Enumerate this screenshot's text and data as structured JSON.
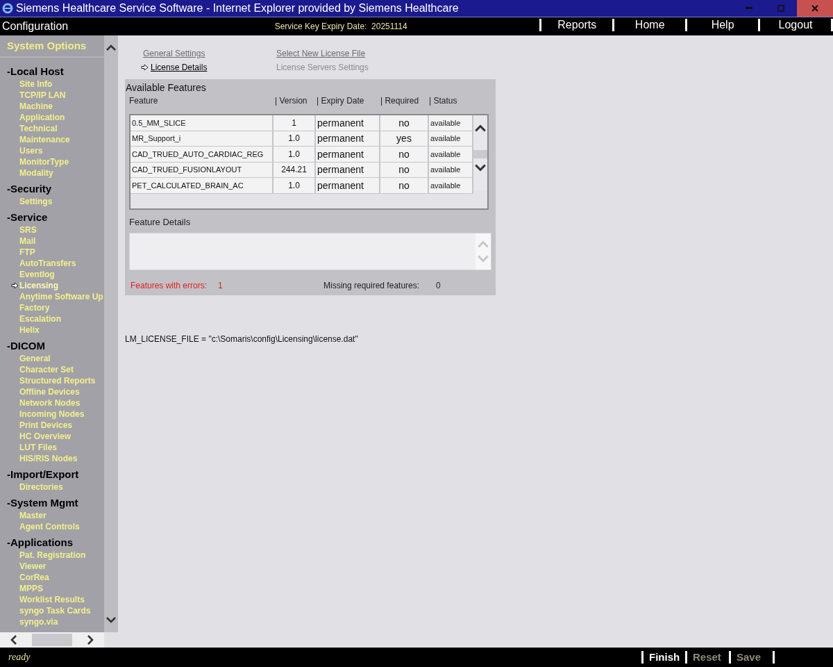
{
  "window": {
    "title": "Siemens Healthcare Service Software - Internet Explorer provided by Siemens Healthcare"
  },
  "header": {
    "title": "Configuration",
    "expiry_label": "Service Key Expiry Date:",
    "expiry_value": "20251114",
    "nav": [
      "Reports",
      "Home",
      "Help",
      "Logout"
    ]
  },
  "sidebar": {
    "title": "System Options",
    "groups": [
      {
        "toggle": "-",
        "label": "Local Host",
        "items": [
          {
            "label": "Site Info",
            "selected": false
          },
          {
            "label": "TCP/IP LAN",
            "selected": false
          },
          {
            "label": "Machine",
            "selected": false
          },
          {
            "label": "Application",
            "selected": false
          },
          {
            "label": "Technical",
            "selected": false
          },
          {
            "label": "Maintenance",
            "selected": false
          },
          {
            "label": "Users",
            "selected": false
          },
          {
            "label": "MonitorType",
            "selected": false
          },
          {
            "label": "Modality",
            "selected": false
          }
        ]
      },
      {
        "toggle": "-",
        "label": "Security",
        "items": [
          {
            "label": "Settings",
            "selected": false
          }
        ]
      },
      {
        "toggle": "-",
        "label": "Service",
        "items": [
          {
            "label": "SRS",
            "selected": false
          },
          {
            "label": "Mail",
            "selected": false
          },
          {
            "label": "FTP",
            "selected": false
          },
          {
            "label": "AutoTransfers",
            "selected": false
          },
          {
            "label": "Eventlog",
            "selected": false
          },
          {
            "label": "Licensing",
            "selected": true
          },
          {
            "label": "Anytime Software Up",
            "selected": false
          },
          {
            "label": "Factory",
            "selected": false
          },
          {
            "label": "Escalation",
            "selected": false
          },
          {
            "label": "Helix",
            "selected": false
          }
        ]
      },
      {
        "toggle": "-",
        "label": "DICOM",
        "items": [
          {
            "label": "General",
            "selected": false
          },
          {
            "label": "Character Set",
            "selected": false
          },
          {
            "label": "Structured Reports",
            "selected": false
          },
          {
            "label": "Offline Devices",
            "selected": false
          },
          {
            "label": "Network Nodes",
            "selected": false
          },
          {
            "label": "Incoming Nodes",
            "selected": false
          },
          {
            "label": "Print Devices",
            "selected": false
          },
          {
            "label": "HC Overview",
            "selected": false
          },
          {
            "label": "LUT Files",
            "selected": false
          },
          {
            "label": "HIS/RIS Nodes",
            "selected": false
          }
        ]
      },
      {
        "toggle": "-",
        "label": "Import/Export",
        "items": [
          {
            "label": "Directories",
            "selected": false
          }
        ]
      },
      {
        "toggle": "-",
        "label": "System Mgmt",
        "items": [
          {
            "label": "Master",
            "selected": false
          },
          {
            "label": "Agent Controls",
            "selected": false
          }
        ]
      },
      {
        "toggle": "-",
        "label": "Applications",
        "items": [
          {
            "label": "Pat. Registration",
            "selected": false
          },
          {
            "label": "Viewer",
            "selected": false
          },
          {
            "label": "CorRea",
            "selected": false
          },
          {
            "label": "MPPS",
            "selected": false
          },
          {
            "label": "Worklist Results",
            "selected": false
          },
          {
            "label": "syngo Task Cards",
            "selected": false
          },
          {
            "label": "syngo.via",
            "selected": false
          }
        ]
      }
    ]
  },
  "tabs": [
    {
      "label": "General Settings",
      "selected": false,
      "disabled": false
    },
    {
      "label": "Select New License File",
      "selected": false,
      "disabled": false
    },
    {
      "label": "License Details",
      "selected": true,
      "disabled": false
    },
    {
      "label": "License Servers Settings",
      "selected": false,
      "disabled": true
    }
  ],
  "features": {
    "title": "Available Features",
    "columns": [
      "Feature",
      "| Version",
      "| Expiry Date",
      "| Required",
      "| Status"
    ],
    "rows": [
      {
        "feature": "0.5_MM_SLICE",
        "version": "1",
        "expiry": "permanent",
        "required": "no",
        "status": "available"
      },
      {
        "feature": "MR_Support_i",
        "version": "1.0",
        "expiry": "permanent",
        "required": "yes",
        "status": "available"
      },
      {
        "feature": "CAD_TRUED_AUTO_CARDIAC_REG",
        "version": "1.0",
        "expiry": "permanent",
        "required": "no",
        "status": "available"
      },
      {
        "feature": "CAD_TRUED_FUSIONLAYOUT",
        "version": "244.21",
        "expiry": "permanent",
        "required": "no",
        "status": "available"
      },
      {
        "feature": "PET_CALCULATED_BRAIN_AC",
        "version": "1.0",
        "expiry": "permanent",
        "required": "no",
        "status": "available"
      }
    ],
    "details_label": "Feature Details",
    "errors_label": "Features with errors:",
    "errors_count": "1",
    "missing_label": "Missing required features:",
    "missing_count": "0"
  },
  "license_file": "LM_LICENSE_FILE = \"c:\\Somaris\\config\\Licensing\\license.dat\"",
  "status_bar": {
    "text": "ready",
    "buttons": [
      {
        "label": "Finish",
        "disabled": false
      },
      {
        "label": "Reset",
        "disabled": true
      },
      {
        "label": "Save",
        "disabled": true
      }
    ]
  }
}
